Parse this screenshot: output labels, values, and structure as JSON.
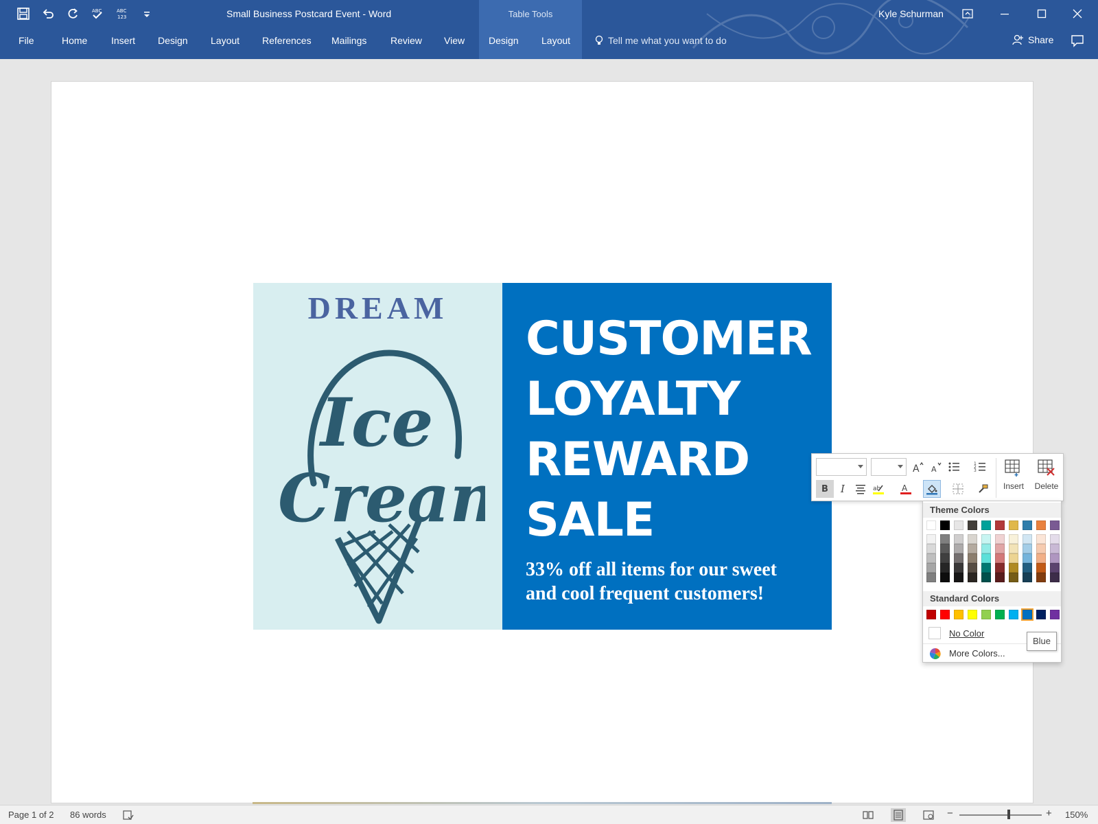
{
  "window": {
    "doc_title": "Small Business Postcard Event  -  Word",
    "context_tab_group": "Table Tools",
    "user_name": "Kyle Schurman"
  },
  "quick_access": {
    "icons": [
      "save-icon",
      "undo-icon",
      "redo-icon",
      "spelling-icon",
      "word-count-icon",
      "customize-icon"
    ]
  },
  "ribbon": {
    "tabs": [
      "File",
      "Home",
      "Insert",
      "Design",
      "Layout",
      "References",
      "Mailings",
      "Review",
      "View",
      "Design",
      "Layout"
    ],
    "active_context_tabs": [
      9,
      10
    ],
    "tell_me": "Tell me what you want to do",
    "share": "Share"
  },
  "postcard": {
    "brand_top": "DREAM",
    "brand_script_1": "Ice",
    "brand_script_2": "Cream",
    "headline_lines": [
      "CUSTOMER",
      "LOYALTY",
      "REWARD",
      "SALE"
    ],
    "subline_1": "33% off all items for our sweet",
    "subline_2": "and cool frequent customers!",
    "colors": {
      "left_bg": "#d8eef0",
      "right_bg": "#0070c0",
      "logo": "#2c5b70",
      "dream": "#4a64a0"
    }
  },
  "mini_toolbar": {
    "font_name": "",
    "font_size": "",
    "bold": "B",
    "italic": "I",
    "insert_label": "Insert",
    "delete_label": "Delete"
  },
  "palette": {
    "theme_header": "Theme Colors",
    "standard_header": "Standard Colors",
    "theme_top": [
      "#ffffff",
      "#000000",
      "#e7e6e6",
      "#44403b",
      "#00a19a",
      "#b23a3a",
      "#e0b84a",
      "#2e7dab",
      "#e9823f",
      "#7a5a93"
    ],
    "theme_shades": [
      [
        "#f2f2f2",
        "#d9d9d9",
        "#bfbfbf",
        "#a6a6a6",
        "#7f7f7f"
      ],
      [
        "#7f7f7f",
        "#595959",
        "#404040",
        "#262626",
        "#0d0d0d"
      ],
      [
        "#d0cece",
        "#aeabab",
        "#757070",
        "#3a3838",
        "#171616"
      ],
      [
        "#d9d5cf",
        "#b4aa9f",
        "#8c7e6e",
        "#574d44",
        "#2b2622"
      ],
      [
        "#c8f5f2",
        "#92ebe6",
        "#5be0d9",
        "#007872",
        "#00504c"
      ],
      [
        "#f0d2d2",
        "#e1a6a6",
        "#d37979",
        "#862b2b",
        "#591d1d"
      ],
      [
        "#f8f1da",
        "#f2e3b7",
        "#ecd492",
        "#b08a22",
        "#755c16"
      ],
      [
        "#d1e6f3",
        "#a3cde7",
        "#75b4db",
        "#225e80",
        "#173f55"
      ],
      [
        "#fbe5d7",
        "#f6cbb0",
        "#f2b088",
        "#c25b16",
        "#813d0f"
      ],
      [
        "#e4dcea",
        "#c9b9d5",
        "#af96c0",
        "#5b436e",
        "#3d2d49"
      ]
    ],
    "standard": [
      "#c00000",
      "#ff0000",
      "#ffc000",
      "#ffff00",
      "#92d050",
      "#00b050",
      "#00b0f0",
      "#0070c0",
      "#002060",
      "#7030a0"
    ],
    "selected_standard": 7,
    "no_color": "No Color",
    "more_colors": "More Colors...",
    "tooltip": "Blue"
  },
  "status_bar": {
    "page": "Page 1 of 2",
    "words": "86 words",
    "zoom": "150%",
    "zoom_minus": "−",
    "zoom_plus": "+",
    "zoom_fraction": 0.6
  }
}
